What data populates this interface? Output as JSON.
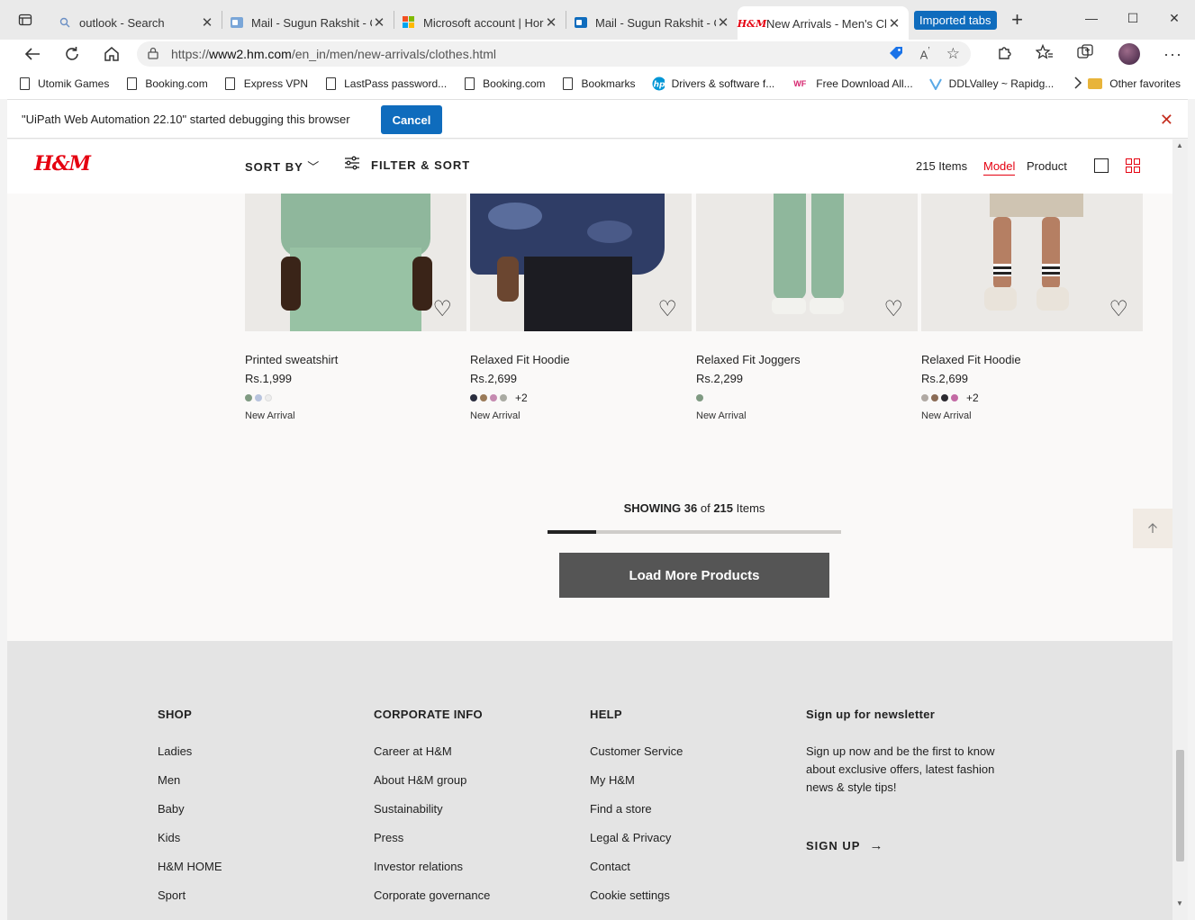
{
  "browser": {
    "tabs": [
      {
        "title": "outlook - Search",
        "icon": "search-icon"
      },
      {
        "title": "Mail - Sugun Rakshit - O",
        "icon": "outlook-icon"
      },
      {
        "title": "Microsoft account | Hor",
        "icon": "microsoft-icon"
      },
      {
        "title": "Mail - Sugun Rakshit - O",
        "icon": "outlook-icon"
      },
      {
        "title": "New Arrivals - Men's Cl",
        "icon": "hm-icon",
        "active": true
      }
    ],
    "imported_tabs_label": "Imported tabs",
    "url_prefix": "https://",
    "url_domain": "www2.hm.com",
    "url_path": "/en_in/men/new-arrivals/clothes.html",
    "favorites": [
      {
        "label": "Utomik Games"
      },
      {
        "label": "Booking.com"
      },
      {
        "label": "Express VPN"
      },
      {
        "label": "LastPass password..."
      },
      {
        "label": "Booking.com"
      },
      {
        "label": "Bookmarks"
      },
      {
        "label": "Drivers & software f..."
      },
      {
        "label": "Free Download All..."
      },
      {
        "label": "DDLValley ~ Rapidg..."
      }
    ],
    "other_favorites": "Other favorites",
    "infobar_text": "\"UiPath Web Automation 22.10\" started debugging this browser",
    "infobar_cancel": "Cancel"
  },
  "hm": {
    "sort_by": "SORT BY",
    "filter_sort": "FILTER & SORT",
    "items_count": "215 Items",
    "view_model": "Model",
    "view_product": "Product"
  },
  "products": [
    {
      "name": "Printed sweatshirt",
      "price": "Rs.1,999",
      "swatches": [
        "#7f9a82",
        "#b7c3dd",
        "#eeeeee"
      ],
      "more": "",
      "badge": "New Arrival"
    },
    {
      "name": "Relaxed Fit Hoodie",
      "price": "Rs.2,699",
      "swatches": [
        "#2a2d3e",
        "#9a7a58",
        "#c58ab0",
        "#a9aaa2"
      ],
      "more": "+2",
      "badge": "New Arrival"
    },
    {
      "name": "Relaxed Fit Joggers",
      "price": "Rs.2,299",
      "swatches": [
        "#7f9a82"
      ],
      "more": "",
      "badge": "New Arrival"
    },
    {
      "name": "Relaxed Fit Hoodie",
      "price": "Rs.2,699",
      "swatches": [
        "#b0a9a3",
        "#8a6b55",
        "#2c2a30",
        "#c36aa4"
      ],
      "more": "+2",
      "badge": "New Arrival"
    }
  ],
  "pagination": {
    "showing_label": "SHOWING",
    "shown": "36",
    "of_label": "of",
    "total": "215",
    "items_label": "Items",
    "progress_fraction": 0.167,
    "load_more": "Load More Products"
  },
  "footer": {
    "shop": {
      "title": "SHOP",
      "items": [
        "Ladies",
        "Men",
        "Baby",
        "Kids",
        "H&M HOME",
        "Sport"
      ]
    },
    "corporate": {
      "title": "CORPORATE INFO",
      "items": [
        "Career at H&M",
        "About H&M group",
        "Sustainability",
        "Press",
        "Investor relations",
        "Corporate governance"
      ]
    },
    "help": {
      "title": "HELP",
      "items": [
        "Customer Service",
        "My H&M",
        "Find a store",
        "Legal & Privacy",
        "Contact",
        "Cookie settings"
      ]
    },
    "newsletter": {
      "title": "Sign up for newsletter",
      "text": "Sign up now and be the first to know about exclusive offers, latest fashion news & style tips!",
      "signup": "SIGN UP"
    }
  },
  "colors": {
    "brand_red": "#e50010",
    "edge_blue": "#0f6cbd",
    "load_more_bg": "#555555"
  }
}
